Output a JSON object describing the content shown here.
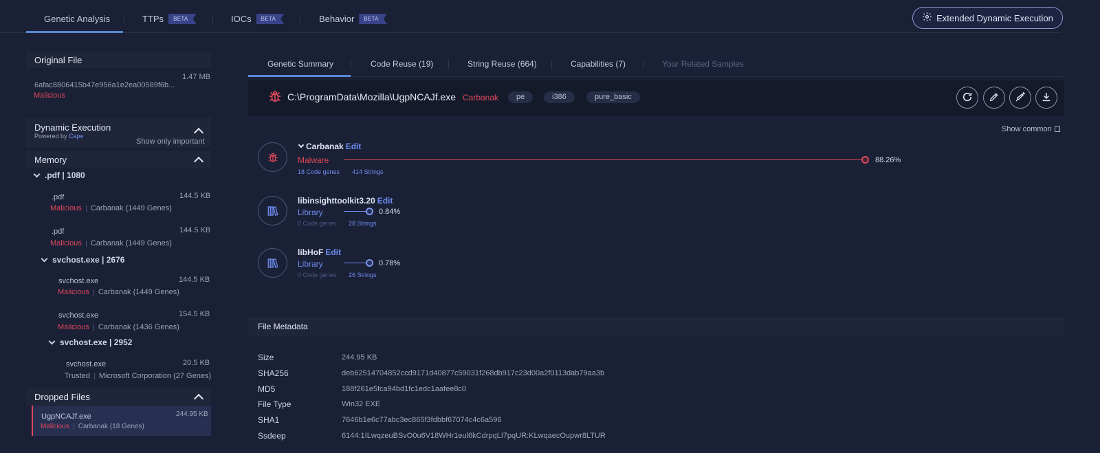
{
  "top_tabs": [
    {
      "label": "Genetic Analysis"
    },
    {
      "label": "TTPs",
      "badge": "BETA"
    },
    {
      "label": "IOCs",
      "badge": "BETA"
    },
    {
      "label": "Behavior",
      "badge": "BETA"
    }
  ],
  "extended_button": "Extended Dynamic Execution",
  "left": {
    "original_file": {
      "title": "Original File",
      "size": "1.47 MB",
      "hash": "6afac8806415b47e956a1e2ea00589f6b...",
      "status": "Malicious"
    },
    "dynamic_execution": {
      "title": "Dynamic Execution",
      "powered_by": "Powered by",
      "powered_link": "Cape",
      "show_important": "Show only important"
    },
    "memory": {
      "title": "Memory",
      "group1": ".pdf  |  1080",
      "items": [
        {
          "name": ".pdf",
          "size": "144.5 KB",
          "status": "Malicious",
          "family": "Carbanak (1449 Genes)"
        },
        {
          "name": ".pdf",
          "size": "144.5 KB",
          "status": "Malicious",
          "family": "Carbanak (1449 Genes)"
        }
      ],
      "group2": "svchost.exe  |  2676",
      "items2": [
        {
          "name": "svchost.exe",
          "size": "144.5 KB",
          "status": "Malicious",
          "family": "Carbanak (1449 Genes)"
        },
        {
          "name": "svchost.exe",
          "size": "154.5 KB",
          "status": "Malicious",
          "family": "Carbanak (1436 Genes)"
        }
      ],
      "group3": "svchost.exe  |  2952",
      "items3": [
        {
          "name": "svchost.exe",
          "size": "20.5 KB",
          "status": "Trusted",
          "family": "Microsoft Corporation (27 Genes)"
        }
      ]
    },
    "dropped_files": {
      "title": "Dropped Files",
      "item": {
        "name": "UgpNCAJf.exe",
        "size": "244.95 KB",
        "status": "Malicious",
        "family": "Carbanak (18 Genes)"
      }
    }
  },
  "sub_tabs": [
    {
      "label": "Genetic Summary"
    },
    {
      "label": "Code Reuse (19)"
    },
    {
      "label": "String Reuse (664)"
    },
    {
      "label": "Capabilities (7)"
    },
    {
      "label": "Your Related Samples"
    }
  ],
  "file": {
    "path": "C:\\ProgramData\\Mozilla\\UgpNCAJf.exe",
    "family": "Carbanak",
    "tags": [
      "pe",
      "i386",
      "pure_basic"
    ]
  },
  "show_common": "Show common",
  "genes": [
    {
      "name": "Carbanak",
      "edit": "Edit",
      "type": "Malware",
      "percent": "88.26%",
      "fraction": 0.8826,
      "code_genes": "18 Code genes",
      "strings": "414 Strings"
    },
    {
      "name": "libinsighttoolkit3.20",
      "edit": "Edit",
      "type": "Library",
      "percent": "0.84%",
      "fraction": 0.0084,
      "code_genes": "0 Code genes",
      "strings": "28 Strings"
    },
    {
      "name": "libHoF",
      "edit": "Edit",
      "type": "Library",
      "percent": "0.78%",
      "fraction": 0.0078,
      "code_genes": "0 Code genes",
      "strings": "26 Strings"
    }
  ],
  "metadata": {
    "title": "File Metadata",
    "rows": [
      {
        "k": "Size",
        "v": "244.95 KB"
      },
      {
        "k": "SHA256",
        "v": "deb62514704852ccd9171d40877c59031f268db917c23d00a2f0113dab79aa3b"
      },
      {
        "k": "MD5",
        "v": "188f261e5fca94bd1fc1edc1aafee8c0"
      },
      {
        "k": "File Type",
        "v": "Win32 EXE"
      },
      {
        "k": "SHA1",
        "v": "7646b1e6c77abc3ec865f3fdbbf67074c4c6a596"
      },
      {
        "k": "Ssdeep",
        "v": "6144:1ILwqzeuBSvO0u6V18WHr1eul6kCdrpqLI7pqUR:KLwqaecOupwr8LTUR"
      }
    ]
  },
  "colors": {
    "malicious": "#e0475b",
    "accent": "#5a86d6",
    "link": "#6f8cf0"
  }
}
